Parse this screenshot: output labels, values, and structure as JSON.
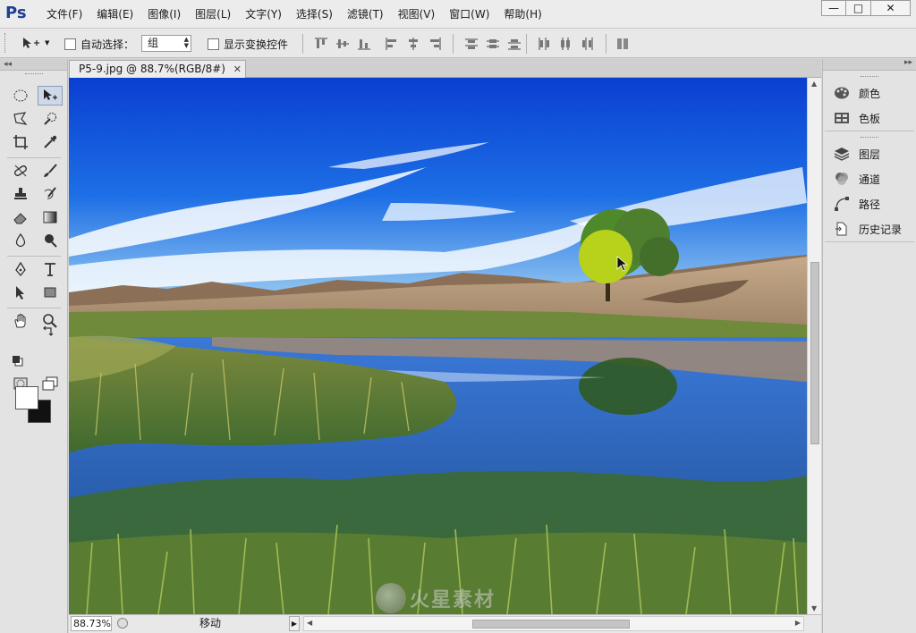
{
  "app": {
    "logo": "Ps"
  },
  "menu": [
    "文件(F)",
    "编辑(E)",
    "图像(I)",
    "图层(L)",
    "文字(Y)",
    "选择(S)",
    "滤镜(T)",
    "视图(V)",
    "窗口(W)",
    "帮助(H)"
  ],
  "window_controls": {
    "minimize": "—",
    "maximize": "□",
    "close": "✕"
  },
  "options": {
    "auto_select_label": "自动选择：",
    "auto_select_value": "组",
    "auto_select_checked": false,
    "show_transform_label": "显示变换控件",
    "show_transform_checked": false
  },
  "toolbar": {
    "collapse": "◂◂"
  },
  "document": {
    "tab_title": "P5-9.jpg @ 88.7%(RGB/8#)",
    "tab_close": "✕"
  },
  "status": {
    "zoom": "88.73%",
    "info": "移动",
    "arrow": "▶"
  },
  "right_dock": {
    "collapse": "▸▸",
    "group1": [
      {
        "icon": "palette-icon",
        "label": "颜色"
      },
      {
        "icon": "swatches-icon",
        "label": "色板"
      }
    ],
    "group2": [
      {
        "icon": "layers-icon",
        "label": "图层"
      },
      {
        "icon": "channels-icon",
        "label": "通道"
      },
      {
        "icon": "paths-icon",
        "label": "路径"
      },
      {
        "icon": "history-icon",
        "label": "历史记录"
      }
    ]
  },
  "colors": {
    "foreground": "#ffffff",
    "background": "#111111",
    "accent": "#1f3f93"
  },
  "watermark": {
    "text": "火星素材"
  }
}
